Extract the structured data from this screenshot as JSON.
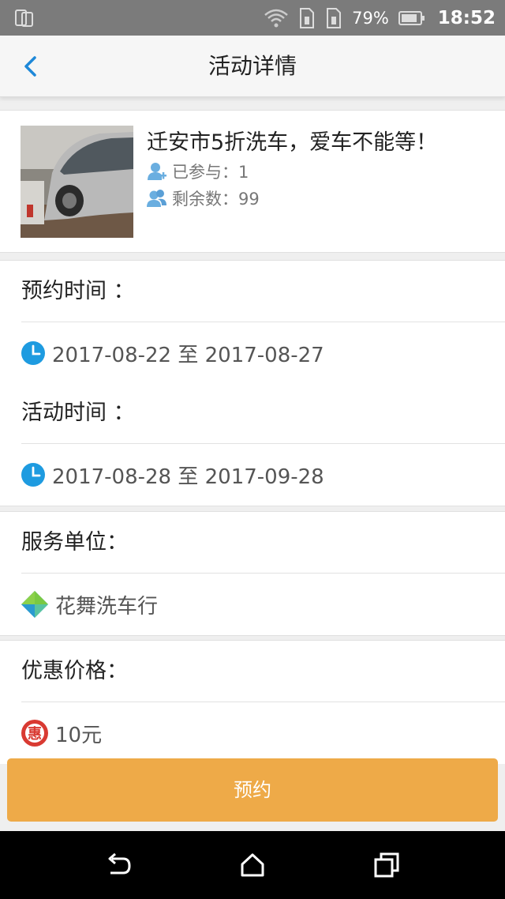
{
  "status_bar": {
    "battery_percent": "79%",
    "time": "18:52"
  },
  "nav": {
    "title": "活动详情"
  },
  "activity": {
    "title": "迁安市5折洗车，爱车不能等！",
    "joined": "已参与：1",
    "remaining": "剩余数：99"
  },
  "booking_time": {
    "label": "预约时间 ：",
    "value": "2017-08-22 至 2017-08-27"
  },
  "activity_time": {
    "label": "活动时间 ：",
    "value": "2017-08-28 至 2017-09-28"
  },
  "service_unit": {
    "label": "服务单位：",
    "value": "花舞洗车行"
  },
  "discount_price": {
    "label": "优惠价格：",
    "value": "10元",
    "badge": "惠"
  },
  "book_button": {
    "label": "预约"
  },
  "colors": {
    "accent_blue": "#1e9be0",
    "button_orange": "#eeaa48",
    "badge_red": "#d93a32"
  },
  "icons": [
    "back-arrow-icon",
    "wifi-icon",
    "sim-icon",
    "battery-icon",
    "user-plus-icon",
    "users-icon",
    "clock-icon",
    "shop-logo-icon",
    "discount-badge-icon",
    "system-back-icon",
    "system-home-icon",
    "system-recents-icon"
  ]
}
